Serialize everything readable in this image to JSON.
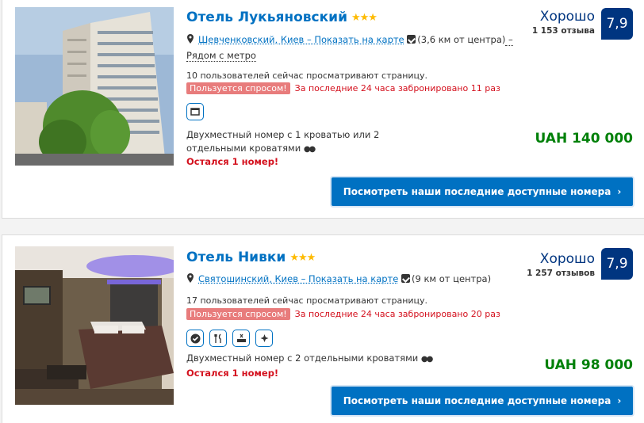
{
  "hotels": [
    {
      "name": "Отель Лукьяновский",
      "stars": "★★★",
      "district_link": "Шевченковский, Киев – Показать на карте",
      "distance": "(3,6 км от центра)",
      "near": " – Рядом с метро",
      "viewers": "10 пользователей сейчас просматривают страницу.",
      "demand_badge": "Пользуется спросом!",
      "booked": "За последние 24 часа забронировано 11 раз",
      "facilities": [
        "tv-icon"
      ],
      "room": "Двухместный номер с 1 кроватью или 2 отдельными кроватями",
      "rooms_left": "Остался 1 номер!",
      "score_word": "Хорошо",
      "reviews": "1 153 отзыва",
      "score": "7,9",
      "price": "UAH 140 000",
      "cta": "Посмотреть наши последние доступные номера"
    },
    {
      "name": "Отель Нивки",
      "stars": "★★★",
      "district_link": "Святошинский, Киев – Показать на карте",
      "distance": "(9 км от центра)",
      "near": "",
      "viewers": "17 пользователей сейчас просматривают страницу.",
      "demand_badge": "Пользуется спросом!",
      "booked": "За последние 24 часа забронировано 20 раз",
      "facilities": [
        "check-icon",
        "restaurant-icon",
        "parking-icon",
        "cleaning-icon"
      ],
      "room": "Двухместный номер с 2 отдельными кроватями",
      "rooms_left": "Остался 1 номер!",
      "score_word": "Хорошо",
      "reviews": "1 257 отзывов",
      "score": "7,9",
      "price": "UAH 98 000",
      "cta": "Посмотреть наши последние доступные номера"
    }
  ],
  "colors": {
    "link": "#0071c2",
    "score_bg": "#003580",
    "price": "#008009",
    "alert": "#d4111e",
    "stars": "#febb02"
  }
}
